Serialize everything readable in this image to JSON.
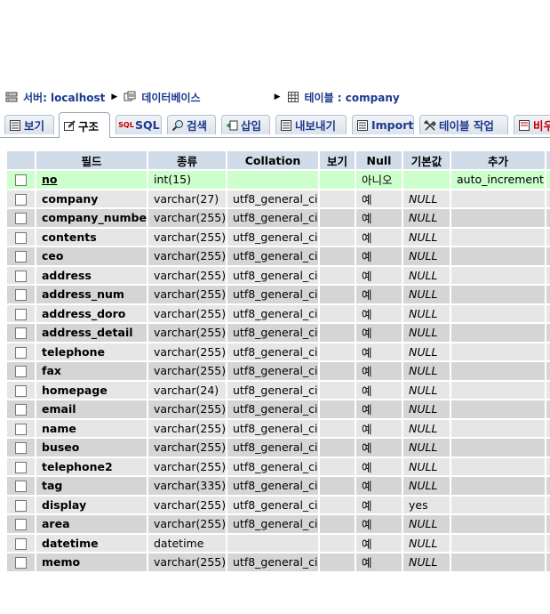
{
  "breadcrumb": {
    "server": "서버: localhost",
    "database": "데이터베이스",
    "table": "테이블 : company"
  },
  "tabs": [
    {
      "label": "보기",
      "icon": "browse-icon"
    },
    {
      "label": "구조",
      "icon": "structure-icon"
    },
    {
      "label": "SQL",
      "icon": "sql-icon"
    },
    {
      "label": "검색",
      "icon": "search-icon"
    },
    {
      "label": "삽입",
      "icon": "insert-icon"
    },
    {
      "label": "내보내기",
      "icon": "export-icon"
    },
    {
      "label": "Import",
      "icon": "import-icon"
    },
    {
      "label": "테이블 작업",
      "icon": "operations-icon"
    },
    {
      "label": "비우",
      "icon": "empty-icon"
    }
  ],
  "columns": [
    "필드",
    "종류",
    "Collation",
    "보기",
    "Null",
    "기본값",
    "추가"
  ],
  "rows": [
    {
      "field": "no",
      "type": "int(15)",
      "collation": "",
      "attr": "",
      "null": "아니오",
      "default": "",
      "extra": "auto_increment"
    },
    {
      "field": "company",
      "type": "varchar(27)",
      "collation": "utf8_general_ci",
      "attr": "",
      "null": "예",
      "default": "NULL",
      "extra": ""
    },
    {
      "field": "company_number",
      "type": "varchar(255)",
      "collation": "utf8_general_ci",
      "attr": "",
      "null": "예",
      "default": "NULL",
      "extra": ""
    },
    {
      "field": "contents",
      "type": "varchar(255)",
      "collation": "utf8_general_ci",
      "attr": "",
      "null": "예",
      "default": "NULL",
      "extra": ""
    },
    {
      "field": "ceo",
      "type": "varchar(255)",
      "collation": "utf8_general_ci",
      "attr": "",
      "null": "예",
      "default": "NULL",
      "extra": ""
    },
    {
      "field": "address",
      "type": "varchar(255)",
      "collation": "utf8_general_ci",
      "attr": "",
      "null": "예",
      "default": "NULL",
      "extra": ""
    },
    {
      "field": "address_num",
      "type": "varchar(255)",
      "collation": "utf8_general_ci",
      "attr": "",
      "null": "예",
      "default": "NULL",
      "extra": ""
    },
    {
      "field": "address_doro",
      "type": "varchar(255)",
      "collation": "utf8_general_ci",
      "attr": "",
      "null": "예",
      "default": "NULL",
      "extra": ""
    },
    {
      "field": "address_detail",
      "type": "varchar(255)",
      "collation": "utf8_general_ci",
      "attr": "",
      "null": "예",
      "default": "NULL",
      "extra": ""
    },
    {
      "field": "telephone",
      "type": "varchar(255)",
      "collation": "utf8_general_ci",
      "attr": "",
      "null": "예",
      "default": "NULL",
      "extra": ""
    },
    {
      "field": "fax",
      "type": "varchar(255)",
      "collation": "utf8_general_ci",
      "attr": "",
      "null": "예",
      "default": "NULL",
      "extra": ""
    },
    {
      "field": "homepage",
      "type": "varchar(24)",
      "collation": "utf8_general_ci",
      "attr": "",
      "null": "예",
      "default": "NULL",
      "extra": ""
    },
    {
      "field": "email",
      "type": "varchar(255)",
      "collation": "utf8_general_ci",
      "attr": "",
      "null": "예",
      "default": "NULL",
      "extra": ""
    },
    {
      "field": "name",
      "type": "varchar(255)",
      "collation": "utf8_general_ci",
      "attr": "",
      "null": "예",
      "default": "NULL",
      "extra": ""
    },
    {
      "field": "buseo",
      "type": "varchar(255)",
      "collation": "utf8_general_ci",
      "attr": "",
      "null": "예",
      "default": "NULL",
      "extra": ""
    },
    {
      "field": "telephone2",
      "type": "varchar(255)",
      "collation": "utf8_general_ci",
      "attr": "",
      "null": "예",
      "default": "NULL",
      "extra": ""
    },
    {
      "field": "tag",
      "type": "varchar(335)",
      "collation": "utf8_general_ci",
      "attr": "",
      "null": "예",
      "default": "NULL",
      "extra": ""
    },
    {
      "field": "display",
      "type": "varchar(255)",
      "collation": "utf8_general_ci",
      "attr": "",
      "null": "예",
      "default": "yes",
      "extra": ""
    },
    {
      "field": "area",
      "type": "varchar(255)",
      "collation": "utf8_general_ci",
      "attr": "",
      "null": "예",
      "default": "NULL",
      "extra": ""
    },
    {
      "field": "datetime",
      "type": "datetime",
      "collation": "",
      "attr": "",
      "null": "예",
      "default": "NULL",
      "extra": ""
    },
    {
      "field": "memo",
      "type": "varchar(255)",
      "collation": "utf8_general_ci",
      "attr": "",
      "null": "예",
      "default": "NULL",
      "extra": ""
    }
  ],
  "colors": {
    "link": "#1a3a8c",
    "header_bg": "#d0dce8",
    "row_odd": "#e6e6e6",
    "row_even": "#d5d5d5",
    "row_highlight": "#ccffcc",
    "danger_tab": "#c00000"
  }
}
